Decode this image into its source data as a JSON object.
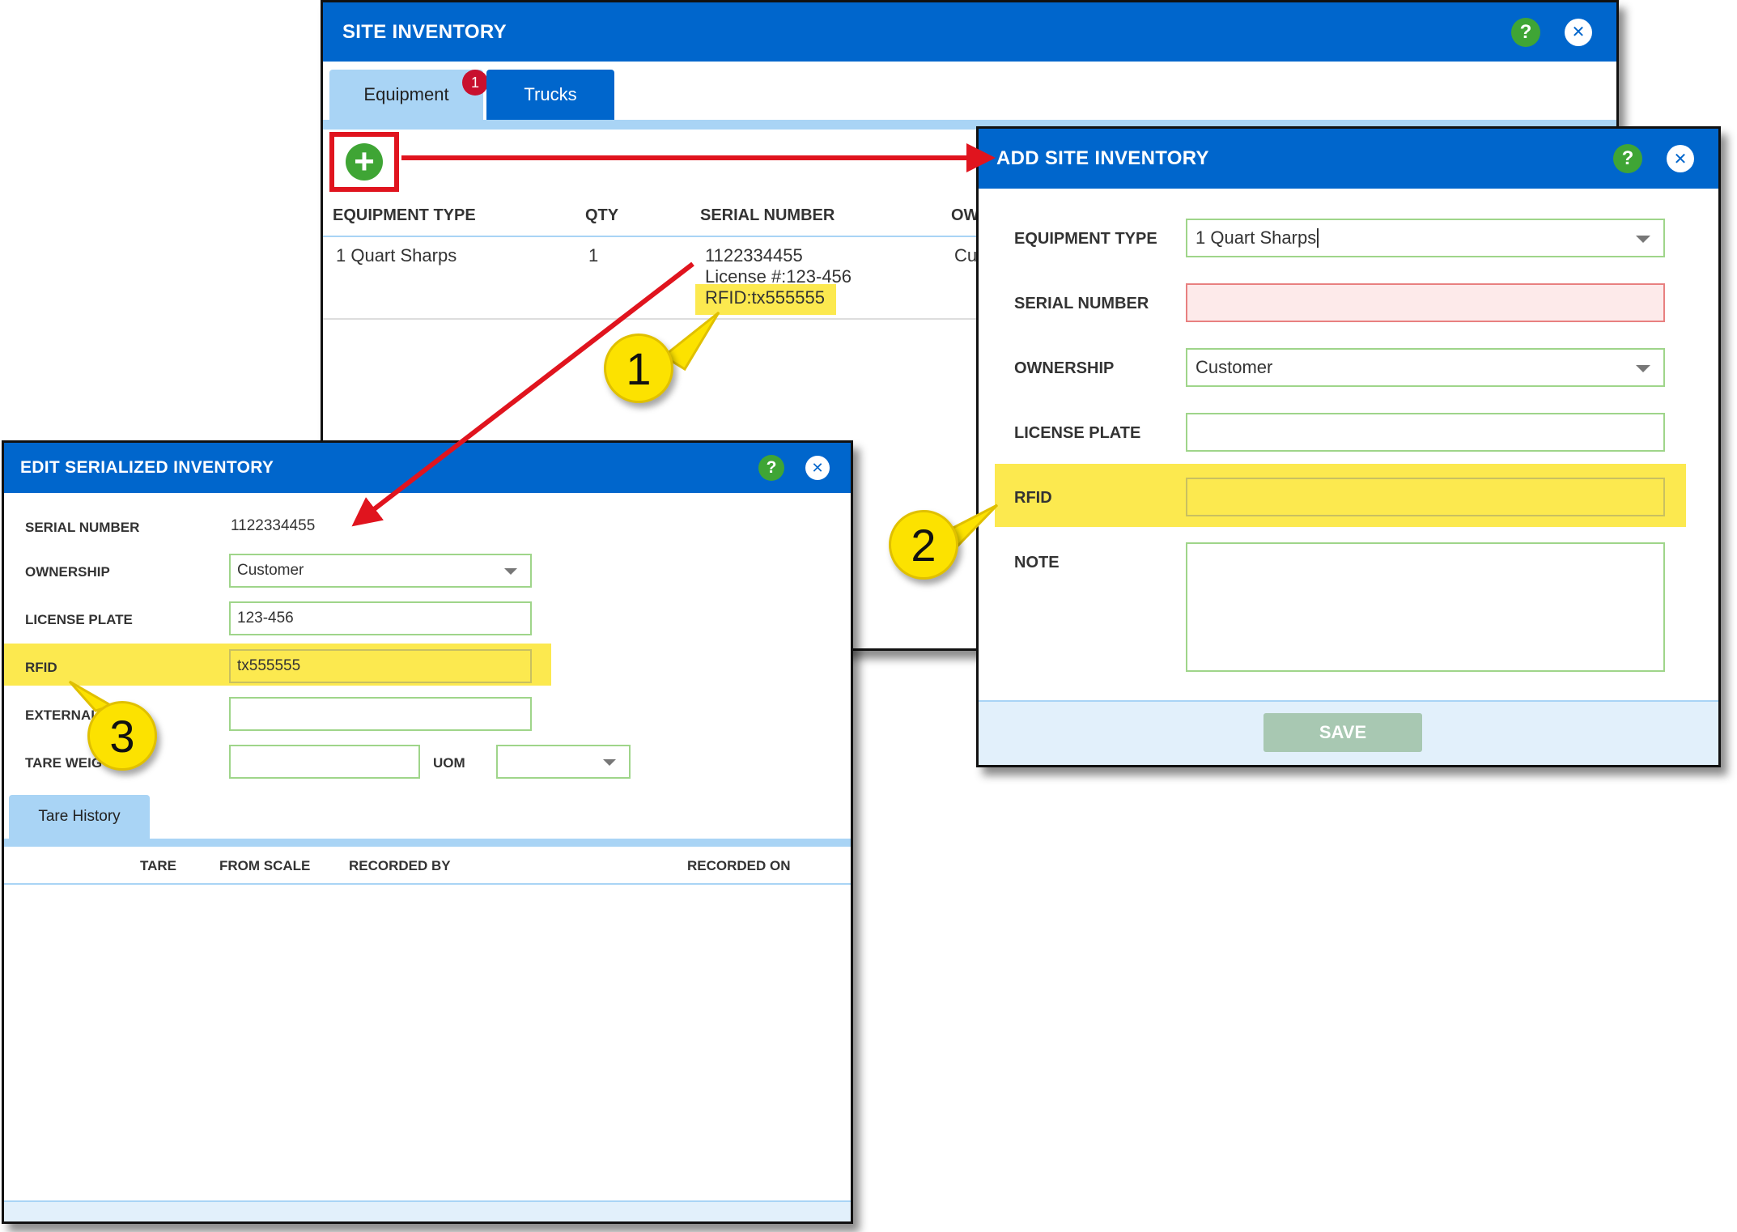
{
  "site_inventory": {
    "title": "SITE INVENTORY",
    "tabs": [
      {
        "label": "Equipment",
        "badge": "1"
      },
      {
        "label": "Trucks"
      }
    ],
    "columns": [
      "EQUIPMENT TYPE",
      "QTY",
      "SERIAL NUMBER",
      "OW"
    ],
    "row": {
      "equipment_type": "1 Quart Sharps",
      "qty": "1",
      "serial": "1122334455",
      "license": "License #:123-456",
      "rfid": "RFID:tx555555",
      "ownership_partial": "Cus"
    }
  },
  "add_site_inventory": {
    "title": "ADD SITE INVENTORY",
    "labels": {
      "equipment_type": "EQUIPMENT TYPE",
      "serial_number": "SERIAL NUMBER",
      "ownership": "OWNERSHIP",
      "license_plate": "LICENSE PLATE",
      "rfid": "RFID",
      "note": "NOTE"
    },
    "values": {
      "equipment_type": "1 Quart Sharps",
      "ownership": "Customer"
    },
    "save_label": "SAVE"
  },
  "edit_serialized_inventory": {
    "title": "EDIT SERIALIZED INVENTORY",
    "labels": {
      "serial_number": "SERIAL NUMBER",
      "ownership": "OWNERSHIP",
      "license_plate": "LICENSE PLATE",
      "rfid": "RFID",
      "external": "EXTERNAL",
      "tare_weight": "TARE WEIG",
      "uom": "UOM"
    },
    "values": {
      "serial_number": "1122334455",
      "ownership": "Customer",
      "license_plate": "123-456",
      "rfid": "tx555555"
    },
    "tab_label": "Tare History",
    "history_columns": [
      "TARE",
      "FROM SCALE",
      "RECORDED BY",
      "RECORDED ON"
    ]
  },
  "callouts": [
    "1",
    "2",
    "3"
  ],
  "icons": {
    "help": "?",
    "close": "✕",
    "add": "+"
  },
  "colors": {
    "title_bar": "#0066cc",
    "highlight": "#fce94f",
    "callout": "#fce200",
    "annotation_red": "#e0141e",
    "help_green": "#3fa535"
  }
}
